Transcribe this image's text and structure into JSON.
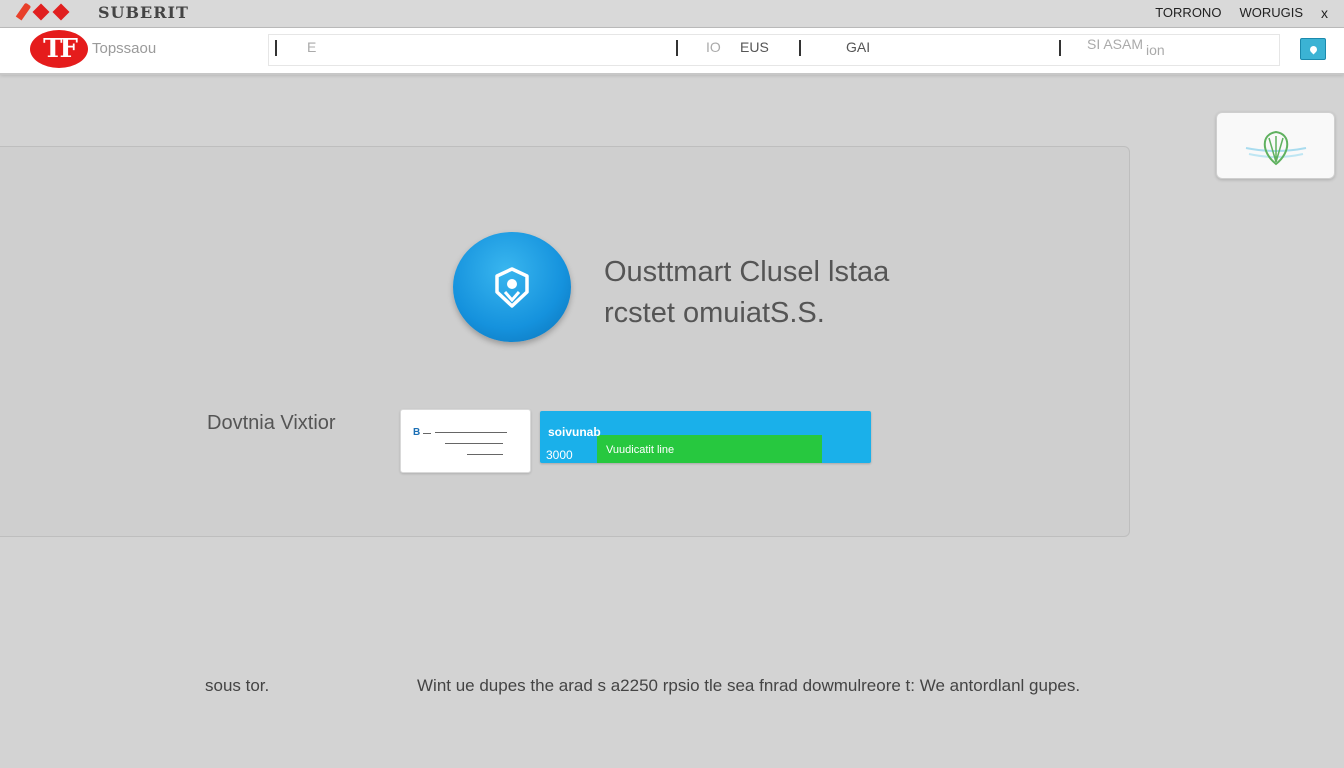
{
  "titlebar": {
    "title": "SUBERIT",
    "right_items": [
      "TORRONO",
      "WORUGIS"
    ],
    "close_label": "x"
  },
  "toolbar": {
    "logo_text": "TF",
    "logo_label": "Topssaou",
    "nav": [
      "E",
      "IO",
      "EUS",
      "GAI",
      "SI ASAM",
      "ion"
    ],
    "button_icon": "pin-icon"
  },
  "widget": {
    "icon": "shell-icon"
  },
  "main": {
    "avatar_icon": "shield-icon",
    "headline_line1": "Ousttmart Clusel lstaa",
    "headline_line2": "rcstet omuiatS.S.",
    "side_label": "Dovtnia Vixtior",
    "mini_card": {
      "mark": "B"
    },
    "progress": {
      "top_label": "soivunab",
      "bottom_label": "3000",
      "fill_label": "Vuudicatit line",
      "value_fraction": 0.82
    }
  },
  "footer": {
    "left": "sous tor.",
    "message": "Wint ue dupes the arad s a2250 rpsio tle sea fnrad dowmulreore t: We antordlanl gupes."
  },
  "colors": {
    "accent_blue": "#1ab0ea",
    "progress_green": "#27c83f",
    "logo_red": "#e51c1c"
  }
}
